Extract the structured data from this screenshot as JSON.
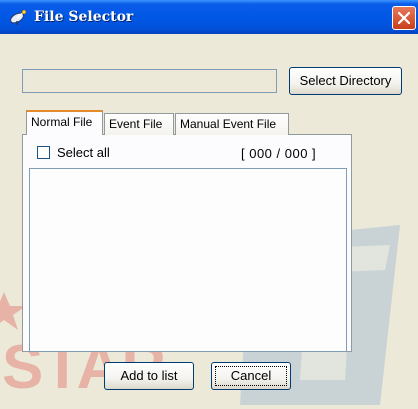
{
  "window": {
    "title": "File Selector",
    "close_symbol": "×",
    "icon": "satellite-icon"
  },
  "path_field": {
    "value": "",
    "placeholder": ""
  },
  "buttons": {
    "select_directory": "Select Directory",
    "add_to_list": "Add to list",
    "cancel": "Cancel"
  },
  "tabs": [
    {
      "label": "Normal File",
      "active": true
    },
    {
      "label": "Event File",
      "active": false
    },
    {
      "label": "Manual Event File",
      "active": false
    }
  ],
  "file_panel": {
    "select_all_label": "Select all",
    "select_all_checked": false,
    "count": "[ 000 / 000 ]",
    "files": []
  },
  "watermark": {
    "logo_text": "STAR",
    "registered": "®"
  },
  "colors": {
    "titlebar": "#0058e6",
    "close_button": "#c8401c",
    "active_tab_accent": "#e68b2c",
    "watermark_blue": "#1c64c8",
    "watermark_red": "#e03a3a"
  }
}
